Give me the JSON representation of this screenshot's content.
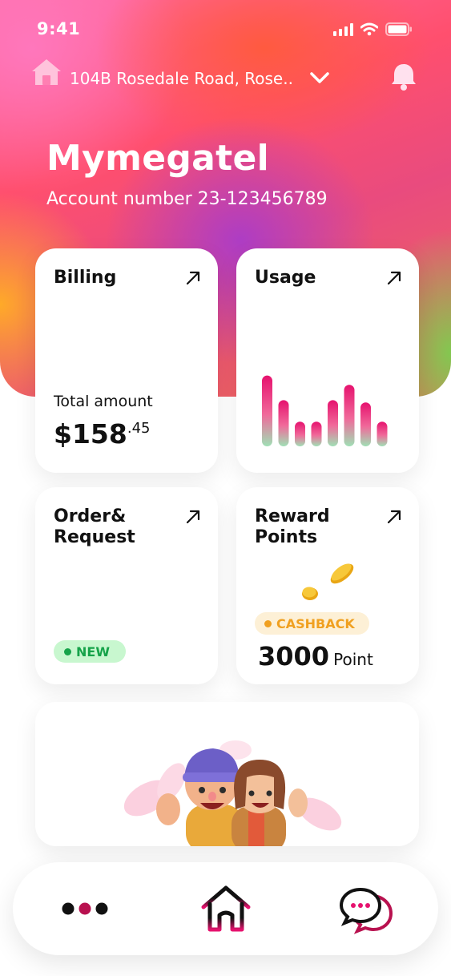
{
  "status_bar": {
    "time": "9:41"
  },
  "header": {
    "address": "104B Rosedale Road, Rose..",
    "brand_name": "Mymegatel",
    "account_number": "Account number 23-123456789"
  },
  "cards": {
    "billing": {
      "title": "Billing",
      "total_label": "Total amount",
      "amount_main": "$158",
      "amount_cents": ".45"
    },
    "usage": {
      "title": "Usage",
      "bar_levels": [
        0.92,
        0.6,
        0.32,
        0.32,
        0.6,
        0.8,
        0.57,
        0.32
      ]
    },
    "orders": {
      "title_line1": "Order&",
      "title_line2": "Request",
      "badge": "NEW"
    },
    "rewards": {
      "title_line1": "Reward",
      "title_line2": "Points",
      "badge": "CASHBACK",
      "points_value": "3000",
      "points_unit": "Point"
    }
  },
  "bottom_nav": {
    "items": [
      "more",
      "home",
      "chat"
    ]
  },
  "colors": {
    "accent": "#e6126e",
    "new_green": "#16a34a",
    "cashback_orange": "#f0a020"
  }
}
